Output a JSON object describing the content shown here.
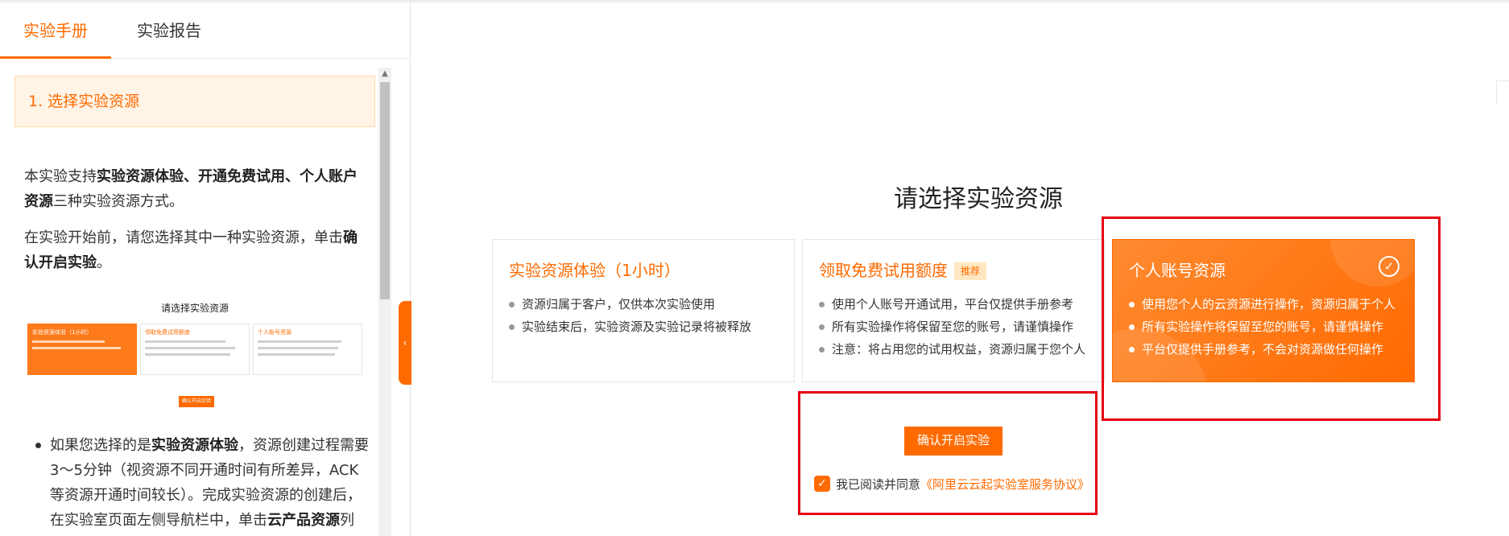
{
  "tabs": [
    {
      "label": "实验手册",
      "active": true
    },
    {
      "label": "实验报告",
      "active": false
    }
  ],
  "manual": {
    "step_title": "1. 选择实验资源",
    "p1": {
      "t1": "本实验支持",
      "b1": "实验资源体验、开通免费试用、个人账户资源",
      "t2": "三种实验资源方式。"
    },
    "p2": {
      "t1": "在实验开始前，请您选择其中一种实验资源，单击",
      "b1": "确认开启实验",
      "t2": "。"
    },
    "bullet": {
      "t1": "如果您选择的是",
      "b1": "实验资源体验",
      "t2": "，资源创建过程需要3～5分钟（视资源不同开通时间有所差异，ACK等资源开通时间较长）。完成实验资源的创建后，在实验室页面左侧导航栏中，单击",
      "b2": "云产品资源",
      "t3": "列表，"
    }
  },
  "thumbnail": {
    "title": "请选择实验资源",
    "cards": [
      "实验资源体验（1小时）",
      "领取免费试用额度",
      "个人账号资源"
    ],
    "button": "确认开启实验"
  },
  "main": {
    "heading": "请选择实验资源",
    "cards": [
      {
        "title": "实验资源体验（1小时）",
        "badge": "",
        "selected": false,
        "items": [
          "资源归属于客户，仅供本次实验使用",
          "实验结束后，实验资源及实验记录将被释放"
        ]
      },
      {
        "title": "领取免费试用额度",
        "badge": "推荐",
        "selected": false,
        "items": [
          "使用个人账号开通试用，平台仅提供手册参考",
          "所有实验操作将保留至您的账号，请谨慎操作",
          "注意：将占用您的试用权益，资源归属于您个人"
        ]
      },
      {
        "title": "个人账号资源",
        "badge": "",
        "selected": true,
        "items": [
          "使用您个人的云资源进行操作，资源归属于个人",
          "所有实验操作将保留至您的账号，请谨慎操作",
          "平台仅提供手册参考，不会对资源做任何操作"
        ]
      }
    ],
    "confirm_button": "确认开启实验",
    "agree_text": "我已阅读并同意",
    "agree_link": "《阿里云云起实验室服务协议》",
    "agree_checked": true
  },
  "icons": {
    "check": "check-circle-icon",
    "collapse": "chevron-left-icon",
    "checkbox": "checkbox-checked-icon"
  },
  "colors": {
    "accent": "#ff6a00",
    "highlight": "#e60012",
    "badge_bg": "#ffe7c2"
  }
}
